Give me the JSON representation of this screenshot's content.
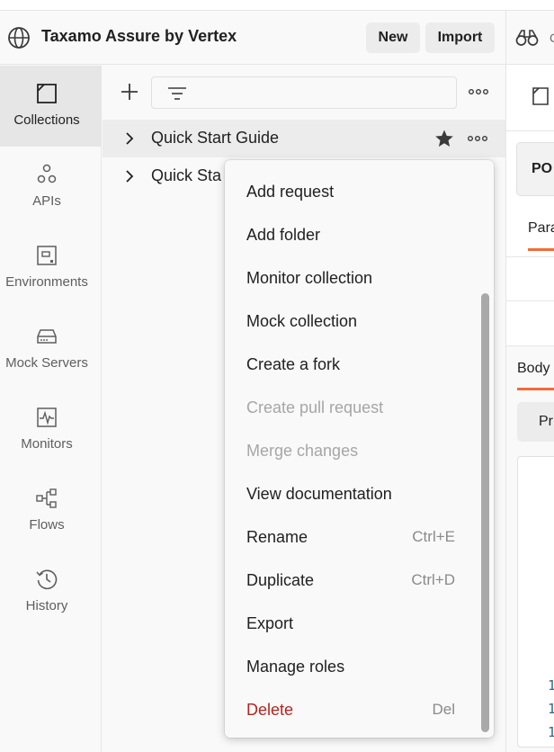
{
  "header": {
    "workspace_name": "Taxamo Assure by Vertex",
    "new_label": "New",
    "import_label": "Import"
  },
  "nav": {
    "items": [
      {
        "label": "Collections",
        "icon": "collections-icon",
        "active": true
      },
      {
        "label": "APIs",
        "icon": "apis-icon"
      },
      {
        "label": "Environments",
        "icon": "environments-icon"
      },
      {
        "label": "Mock Servers",
        "icon": "mock-servers-icon"
      },
      {
        "label": "Monitors",
        "icon": "monitors-icon"
      },
      {
        "label": "Flows",
        "icon": "flows-icon"
      },
      {
        "label": "History",
        "icon": "history-icon"
      }
    ]
  },
  "tree": {
    "search": {
      "value": "",
      "placeholder": ""
    },
    "collections": [
      {
        "label": "Quick Start Guide",
        "starred": true
      },
      {
        "label": "Quick Sta"
      }
    ]
  },
  "context_menu": {
    "items": [
      {
        "label": "Add request"
      },
      {
        "label": "Add folder"
      },
      {
        "label": "Monitor collection"
      },
      {
        "label": "Mock collection"
      },
      {
        "label": "Create a fork"
      },
      {
        "label": "Create pull request",
        "disabled": true
      },
      {
        "label": "Merge changes",
        "disabled": true
      },
      {
        "label": "View documentation"
      },
      {
        "label": "Rename",
        "shortcut": "Ctrl+E"
      },
      {
        "label": "Duplicate",
        "shortcut": "Ctrl+D"
      },
      {
        "label": "Export"
      },
      {
        "label": "Manage roles"
      },
      {
        "label": "Delete",
        "shortcut": "Del",
        "danger": true
      }
    ]
  },
  "request_pane": {
    "method": "PO",
    "tab_params": "Para",
    "body_tab": "Body",
    "body_mode": "Pr",
    "line_numbers": [
      "1",
      "1",
      "1"
    ]
  },
  "colors": {
    "accent": "#f26b3a",
    "danger": "#b2251f",
    "disabled": "#a6a6a6"
  }
}
